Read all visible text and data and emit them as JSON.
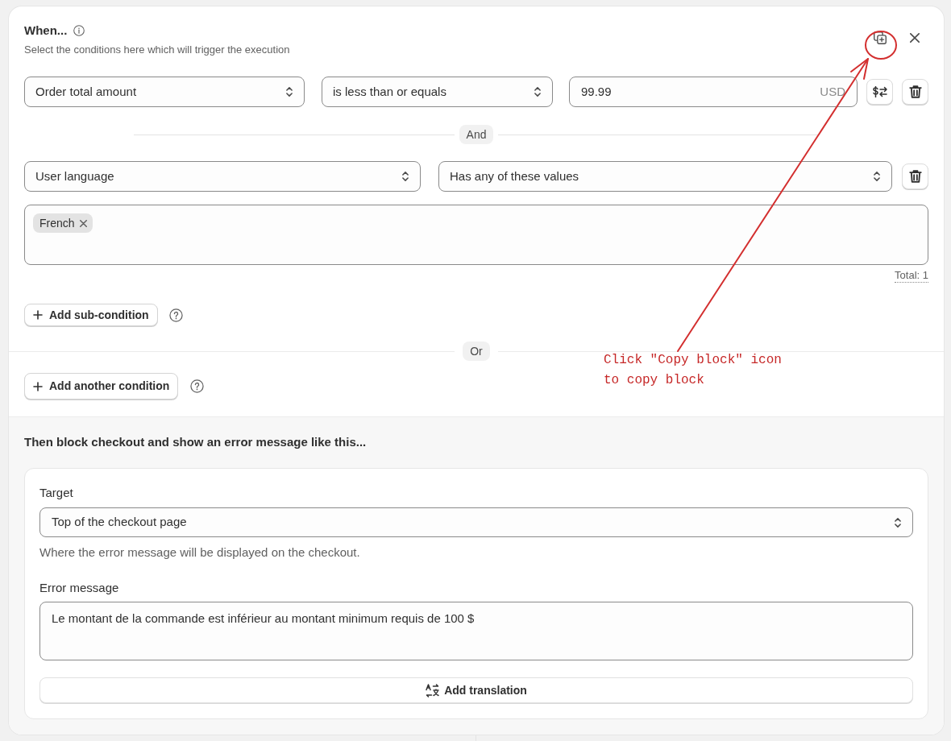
{
  "condition_block": {
    "title": "When...",
    "subtitle": "Select the conditions here which will trigger the execution",
    "conditions": [
      {
        "kind": "amount",
        "field": "Order total amount",
        "operator": "is less than or equals",
        "value": "99.99",
        "currency": "USD"
      },
      {
        "kind": "values",
        "field": "User language",
        "operator": "Has any of these values",
        "tags": [
          {
            "label": "French"
          }
        ],
        "total": "Total: 1"
      }
    ],
    "joiner": "And",
    "add_sub_button": "Add sub-condition",
    "or_label": "Or",
    "add_condition_button": "Add another condition"
  },
  "action_block": {
    "title": "Then block checkout and show an error message like this...",
    "target_label": "Target",
    "target_value": "Top of the checkout page",
    "target_help": "Where the error message will be displayed on the checkout.",
    "message_label": "Error message",
    "message_value": "Le montant de la commande est inférieur au montant minimum requis de 100 $",
    "translation_button": "Add translation"
  },
  "annotation": {
    "text": "Click \"Copy block\" icon to copy block"
  }
}
